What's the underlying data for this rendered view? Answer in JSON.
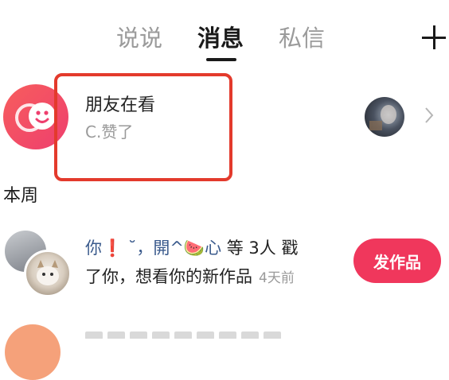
{
  "tabs": [
    {
      "label": "说说",
      "active": false
    },
    {
      "label": "消息",
      "active": true
    },
    {
      "label": "私信",
      "active": false
    }
  ],
  "header": {
    "add_icon": "plus-icon"
  },
  "friends_watching": {
    "title": "朋友在看",
    "subtitle": "C.赞了",
    "icon": "smiley-chat-icon",
    "highlight_color": "#e33a2c"
  },
  "section_title": "本周",
  "notification": {
    "names": "你❗ ˘，開^🍉心",
    "text_mid": " 等 3人 戳",
    "text_line2": "了你，想看你的新作品",
    "time": "4天前",
    "button_label": "发作品",
    "button_color": "#f0375c"
  },
  "colors": {
    "accent": "#f0375c",
    "link_name": "#3a5a8c",
    "muted": "#9a9a9a"
  }
}
